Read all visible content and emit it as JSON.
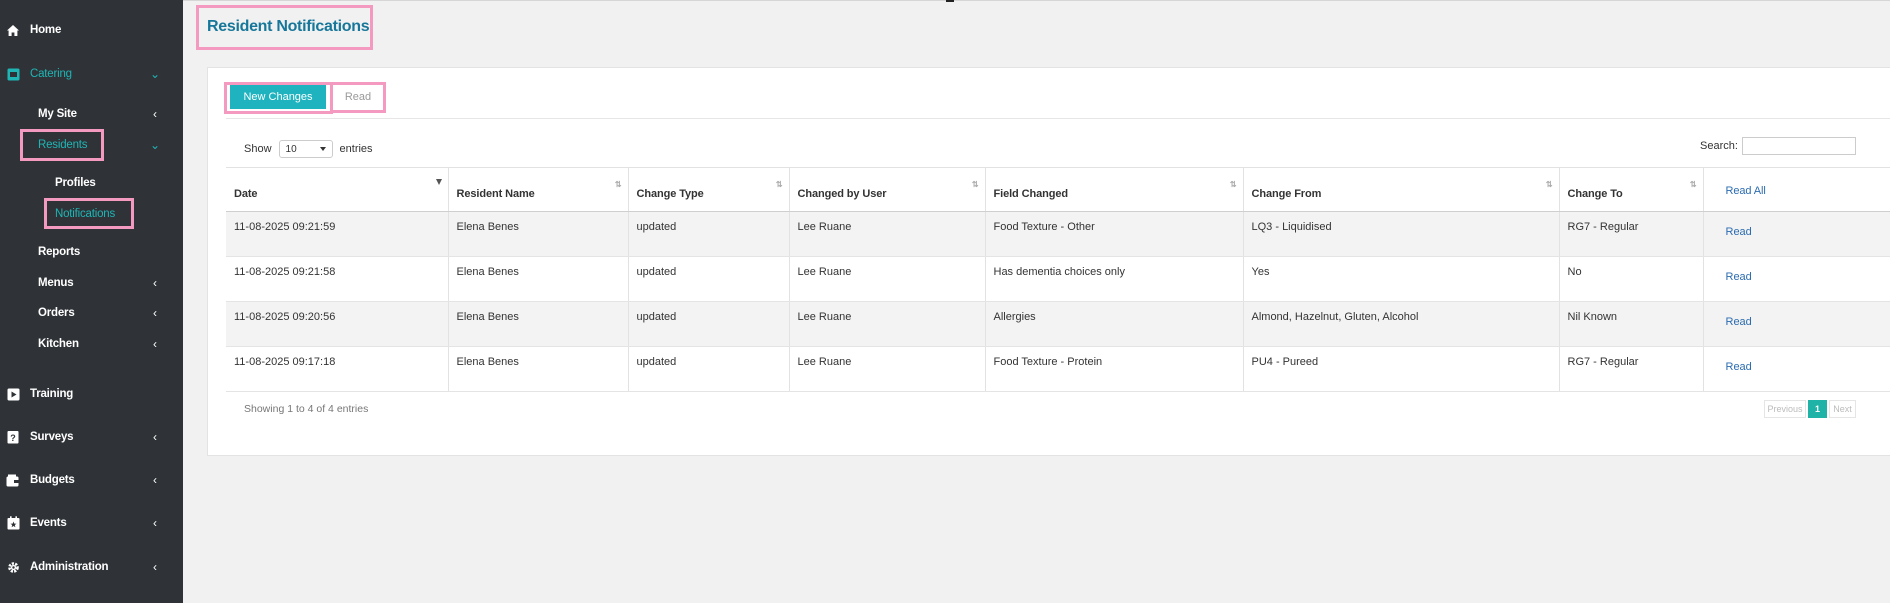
{
  "sidebar": {
    "home": "Home",
    "catering": "Catering",
    "my_site": "My Site",
    "residents": "Residents",
    "profiles": "Profiles",
    "notifications": "Notifications",
    "reports": "Reports",
    "menus": "Menus",
    "orders": "Orders",
    "kitchen": "Kitchen",
    "training": "Training",
    "surveys": "Surveys",
    "budgets": "Budgets",
    "events": "Events",
    "administration": "Administration"
  },
  "page": {
    "title": "Resident Notifications"
  },
  "tabs": {
    "new_changes": "New Changes",
    "read": "Read"
  },
  "length": {
    "show": "Show",
    "value": "10",
    "entries": "entries"
  },
  "search": {
    "label": "Search:",
    "value": ""
  },
  "table": {
    "headers": {
      "date": "Date",
      "resident": "Resident Name",
      "type": "Change Type",
      "user": "Changed by User",
      "field": "Field Changed",
      "from": "Change From",
      "to": "Change To",
      "action": "Read All"
    },
    "rows": [
      {
        "date": "11-08-2025 09:21:59",
        "resident": "Elena Benes",
        "type": "updated",
        "user": "Lee Ruane",
        "field": "Food Texture - Other",
        "from": "LQ3 - Liquidised",
        "to": "RG7 - Regular",
        "action": "Read"
      },
      {
        "date": "11-08-2025 09:21:58",
        "resident": "Elena Benes",
        "type": "updated",
        "user": "Lee Ruane",
        "field": "Has dementia choices only",
        "from": "Yes",
        "to": "No",
        "action": "Read"
      },
      {
        "date": "11-08-2025 09:20:56",
        "resident": "Elena Benes",
        "type": "updated",
        "user": "Lee Ruane",
        "field": "Allergies",
        "from": "Almond, Hazelnut, Gluten, Alcohol",
        "to": "Nil Known",
        "action": "Read"
      },
      {
        "date": "11-08-2025 09:17:18",
        "resident": "Elena Benes",
        "type": "updated",
        "user": "Lee Ruane",
        "field": "Food Texture - Protein",
        "from": "PU4 - Pureed",
        "to": "RG7 - Regular",
        "action": "Read"
      }
    ]
  },
  "info": "Showing 1 to 4 of 4 entries",
  "pagination": {
    "previous": "Previous",
    "current": "1",
    "next": "Next"
  },
  "colors": {
    "sidebar_bg": "#2f3337",
    "accent": "#1eb3bf",
    "title": "#17779a",
    "highlight": "#f49ac1",
    "link": "#2b6cb0"
  }
}
